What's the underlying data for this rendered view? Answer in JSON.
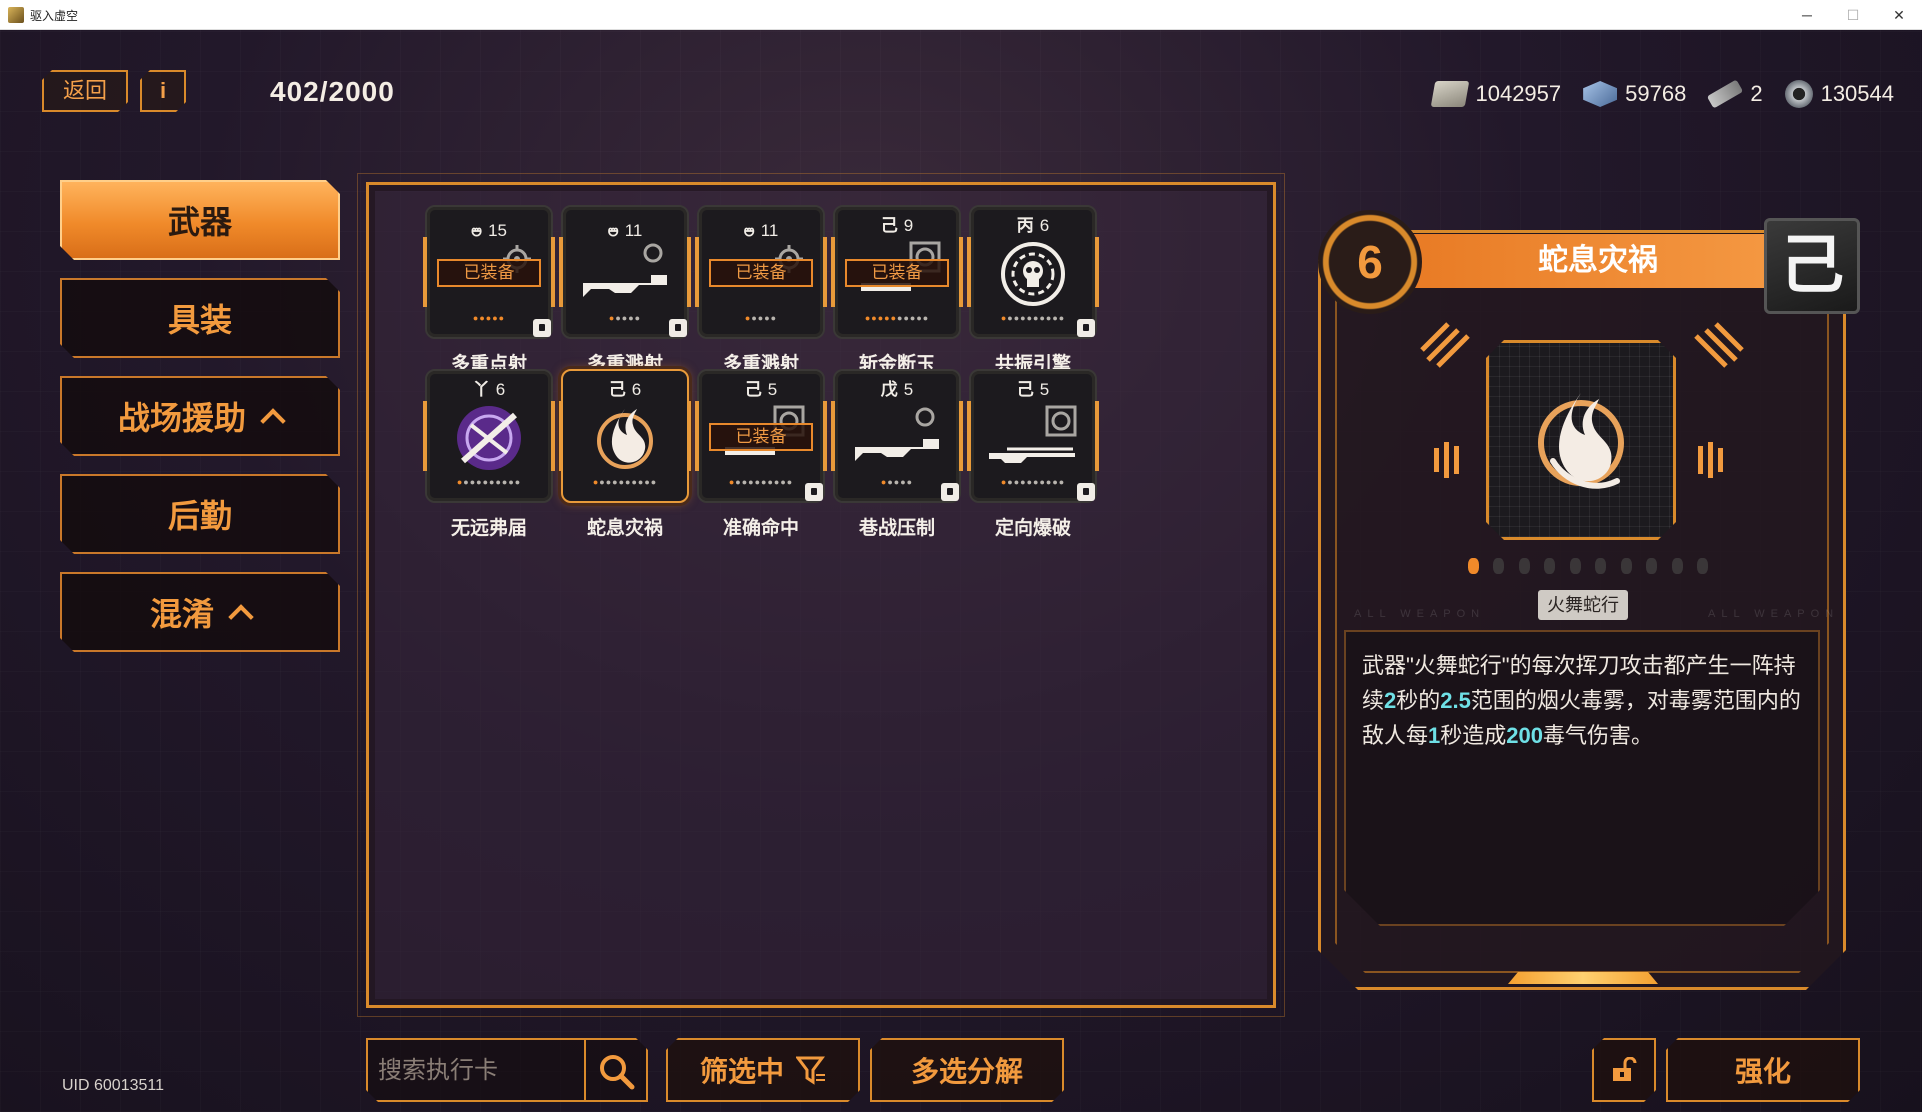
{
  "window": {
    "title": "驱入虚空",
    "minimize_glyph": "─",
    "maximize_glyph": "☐",
    "close_glyph": "✕"
  },
  "top_bar": {
    "back_label": "返回",
    "info_label": "i",
    "card_count": "402/2000"
  },
  "currencies": [
    {
      "icon": "cash-icon",
      "value": "1042957"
    },
    {
      "icon": "cube-icon",
      "value": "59768"
    },
    {
      "icon": "chip-icon",
      "value": "2"
    },
    {
      "icon": "gear-icon",
      "value": "130544"
    }
  ],
  "sidebar": {
    "tabs": [
      {
        "label": "武器",
        "active": true,
        "chevron": false
      },
      {
        "label": "具装",
        "active": false,
        "chevron": false
      },
      {
        "label": "战场援助",
        "active": false,
        "chevron": true
      },
      {
        "label": "后勤",
        "active": false,
        "chevron": false
      },
      {
        "label": "混淆",
        "active": false,
        "chevron": true
      }
    ]
  },
  "uid": "UID 60013511",
  "cards": [
    {
      "rank_glyph": "🜰",
      "level": "15",
      "name": "多重点射",
      "equipped": true,
      "equipped_label": "已装备",
      "art": "gear",
      "dots_on": 5,
      "dots_total": 5,
      "locked": true
    },
    {
      "rank_glyph": "🜰",
      "level": "11",
      "name": "多重溅射",
      "equipped": false,
      "equipped_label": "",
      "art": "gun",
      "dots_on": 1,
      "dots_total": 5,
      "locked": true
    },
    {
      "rank_glyph": "🜰",
      "level": "11",
      "name": "多重溅射",
      "equipped": true,
      "equipped_label": "已装备",
      "art": "gear",
      "dots_on": 1,
      "dots_total": 5,
      "locked": false
    },
    {
      "rank_glyph": "己",
      "level": "9",
      "name": "斩金断玉",
      "equipped": true,
      "equipped_label": "已装备",
      "art": "target",
      "dots_on": 5,
      "dots_total": 10,
      "locked": false
    },
    {
      "rank_glyph": "丙",
      "level": "6",
      "name": "共振引擎",
      "equipped": false,
      "equipped_label": "",
      "art": "skull",
      "dots_on": 1,
      "dots_total": 10,
      "locked": true
    },
    {
      "rank_glyph": "丫",
      "level": "6",
      "name": "无远弗届",
      "equipped": false,
      "equipped_label": "",
      "art": "cross",
      "dots_on": 1,
      "dots_total": 10,
      "locked": false
    },
    {
      "rank_glyph": "己",
      "level": "6",
      "name": "蛇息灾祸",
      "equipped": false,
      "equipped_label": "",
      "art": "flame",
      "dots_on": 1,
      "dots_total": 10,
      "locked": false,
      "selected": true
    },
    {
      "rank_glyph": "己",
      "level": "5",
      "name": "准确命中",
      "equipped": true,
      "equipped_label": "已装备",
      "art": "target",
      "dots_on": 1,
      "dots_total": 10,
      "locked": true
    },
    {
      "rank_glyph": "戊",
      "level": "5",
      "name": "巷战压制",
      "equipped": false,
      "equipped_label": "",
      "art": "gun",
      "dots_on": 1,
      "dots_total": 5,
      "locked": true
    },
    {
      "rank_glyph": "己",
      "level": "5",
      "name": "定向爆破",
      "equipped": false,
      "equipped_label": "",
      "art": "rifle",
      "dots_on": 1,
      "dots_total": 10,
      "locked": true
    }
  ],
  "bottom": {
    "search_placeholder": "搜索执行卡",
    "filter_label": "筛选中",
    "multi_label": "多选分解",
    "enhance_label": "强化"
  },
  "detail": {
    "level": "6",
    "title": "蛇息灾祸",
    "rank_glyph": "己",
    "page_dots_on": 1,
    "page_dots_total": 10,
    "subtitle": "火舞蛇行",
    "ghost_left": "ALL WEAPON",
    "ghost_right": "ALL WEAPON",
    "desc_parts": [
      {
        "t": "武器\"火舞蛇行\"的每次挥刀攻击都产生一阵持续",
        "hl": false
      },
      {
        "t": "2",
        "hl": true
      },
      {
        "t": "秒的",
        "hl": false
      },
      {
        "t": "2.5",
        "hl": true
      },
      {
        "t": "范围的烟火毒雾，对毒雾范围内的敌人每",
        "hl": false
      },
      {
        "t": "1",
        "hl": true
      },
      {
        "t": "秒造成",
        "hl": false
      },
      {
        "t": "200",
        "hl": true
      },
      {
        "t": "毒气伤害。",
        "hl": false
      }
    ]
  },
  "colors": {
    "accent": "#d98a2b",
    "accent_bright": "#f29a3e",
    "highlight": "#6fe0e6",
    "background": "#22182a"
  }
}
